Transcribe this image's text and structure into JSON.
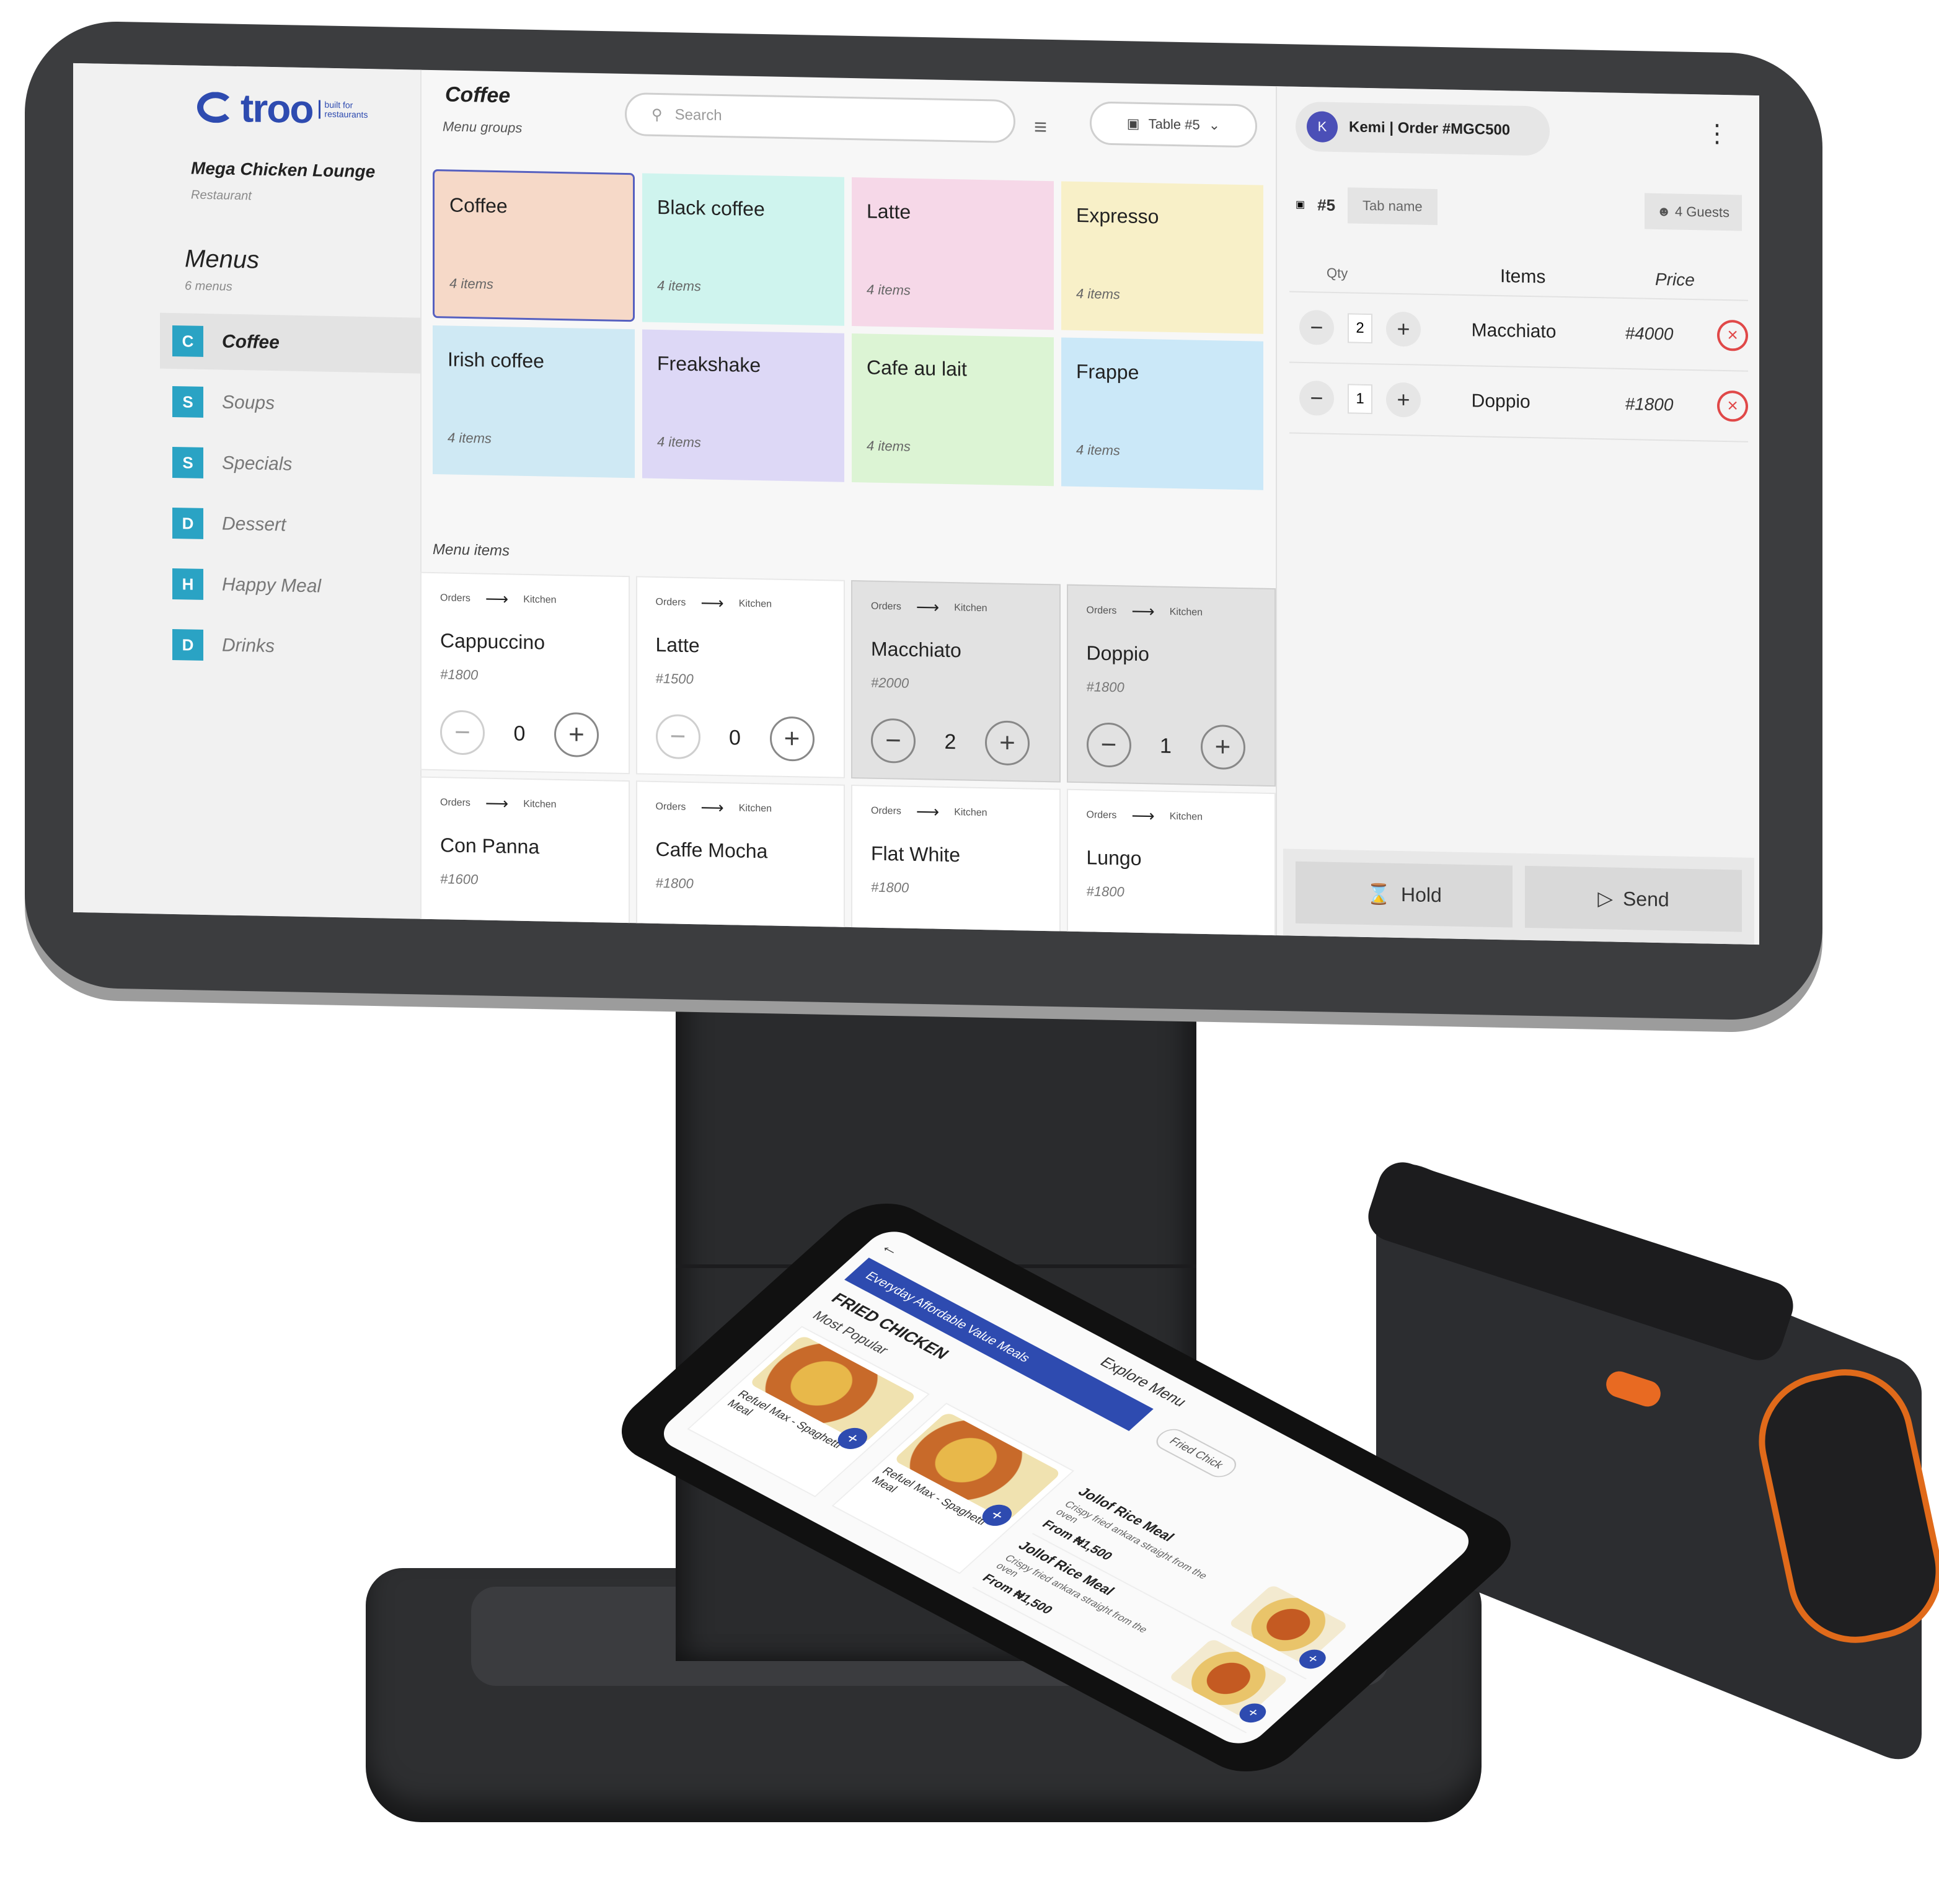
{
  "brand": {
    "name": "troo",
    "tagline": "built for restaurants",
    "color": "#2e4bb0"
  },
  "venue": {
    "name": "Mega Chicken Lounge",
    "type": "Restaurant"
  },
  "menus": {
    "title": "Menus",
    "count": "6 menus",
    "items": [
      {
        "badge": "C",
        "label": "Coffee"
      },
      {
        "badge": "S",
        "label": "Soups"
      },
      {
        "badge": "S",
        "label": "Specials"
      },
      {
        "badge": "D",
        "label": "Dessert"
      },
      {
        "badge": "H",
        "label": "Happy Meal"
      },
      {
        "badge": "D",
        "label": "Drinks"
      }
    ]
  },
  "main": {
    "title": "Coffee",
    "subtitle": "Menu groups",
    "search_placeholder": "Search",
    "table_selector": "Table #5",
    "groups": [
      {
        "name": "Coffee",
        "count": "4 items",
        "color": "#f6d9c8"
      },
      {
        "name": "Black coffee",
        "count": "4 items",
        "color": "#cff4ee"
      },
      {
        "name": "Latte",
        "count": "4 items",
        "color": "#f6d8e8"
      },
      {
        "name": "Expresso",
        "count": "4 items",
        "color": "#f8f0c8"
      },
      {
        "name": "Irish coffee",
        "count": "4 items",
        "color": "#cfe9f4"
      },
      {
        "name": "Freakshake",
        "count": "4 items",
        "color": "#ddd8f6"
      },
      {
        "name": "Cafe au lait",
        "count": "4 items",
        "color": "#dcf4d4"
      },
      {
        "name": "Frappe",
        "count": "4 items",
        "color": "#cbe8f8"
      }
    ],
    "menu_items_label": "Menu items",
    "flow_from": "Orders",
    "flow_to": "Kitchen",
    "items": [
      {
        "name": "Cappuccino",
        "price": "#1800",
        "qty": "0"
      },
      {
        "name": "Latte",
        "price": "#1500",
        "qty": "0"
      },
      {
        "name": "Macchiato",
        "price": "#2000",
        "qty": "2"
      },
      {
        "name": "Doppio",
        "price": "#1800",
        "qty": "1"
      },
      {
        "name": "Con Panna",
        "price": "#1600",
        "qty": ""
      },
      {
        "name": "Caffe Mocha",
        "price": "#1800",
        "qty": ""
      },
      {
        "name": "Flat White",
        "price": "#1800",
        "qty": ""
      },
      {
        "name": "Lungo",
        "price": "#1800",
        "qty": ""
      }
    ]
  },
  "order": {
    "avatar": "K",
    "title": "Kemi | Order #MGC500",
    "table": "#5",
    "tab_name": "Tab name",
    "guests": "4 Guests",
    "headers": {
      "qty": "Qty",
      "items": "Items",
      "price": "Price"
    },
    "rows": [
      {
        "qty": "2",
        "item": "Macchiato",
        "price": "#4000"
      },
      {
        "qty": "1",
        "item": "Doppio",
        "price": "#1800"
      }
    ],
    "hold_label": "Hold",
    "send_label": "Send"
  },
  "handheld": {
    "title": "Explore Menu",
    "banner": "Everyday Affordable Value Meals",
    "category": "FRIED CHICKEN",
    "section": "Most Popular",
    "chip": "Fried Chick",
    "cards": [
      {
        "name": "Refuel Max - Spaghetti Meal"
      },
      {
        "name": "Refuel Max - Spaghetti Meal"
      }
    ],
    "list": [
      {
        "name": "Jollof Rice Meal",
        "desc": "Crispy fried ankara straight from the oven",
        "price": "From ₦1,500"
      },
      {
        "name": "Jollof Rice Meal",
        "desc": "Crispy fried ankara straight from the oven",
        "price": "From ₦1,500"
      }
    ]
  }
}
